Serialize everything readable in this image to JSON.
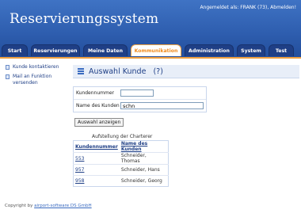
{
  "app": {
    "title": "Reservierungssystem"
  },
  "login": {
    "text": "Angemeldet als: FRANK (73),",
    "logout_label": "Abmelden!"
  },
  "nav": {
    "tabs": [
      {
        "label": "Start"
      },
      {
        "label": "Reservierungen"
      },
      {
        "label": "Meine Daten"
      },
      {
        "label": "Kommunikation",
        "active": true
      },
      {
        "label": "Administration"
      },
      {
        "label": "System"
      },
      {
        "label": "Test"
      }
    ]
  },
  "sidebar": {
    "items": [
      {
        "label": "Kunde kontaktieren"
      },
      {
        "label": "Mail an Funktion versenden"
      }
    ]
  },
  "page": {
    "title": "Auswahl Kunde   (?)"
  },
  "form": {
    "kundennummer_label": "Kundennummer",
    "kundennummer_value": "",
    "name_label": "Name des Kunden",
    "name_value": "schn",
    "submit_label": "Auswahl anzeigen"
  },
  "results": {
    "caption": "Aufstellung der Charterer",
    "headers": [
      "Kundennummer",
      "Name des Kunden"
    ],
    "rows": [
      {
        "nummer": "553",
        "name": "Schneider, Thomas"
      },
      {
        "nummer": "957",
        "name": "Schneider, Hans"
      },
      {
        "nummer": "958",
        "name": "Schneider, Georg"
      }
    ]
  },
  "footer": {
    "prefix": "Copyright by",
    "link": "airport-software DS GmbH"
  },
  "colors": {
    "header_blue": "#2f5fb0",
    "tab_blue": "#1f3f86",
    "accent_orange": "#f08a1c"
  }
}
